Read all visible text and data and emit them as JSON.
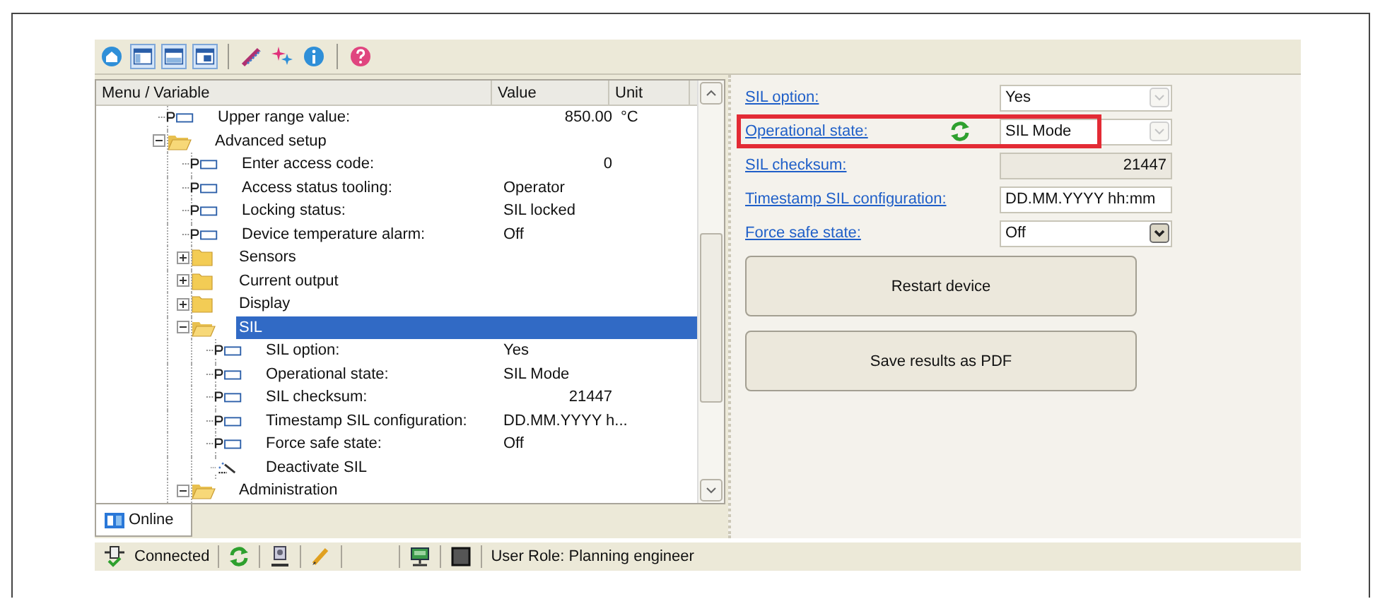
{
  "tree": {
    "columns": [
      "Menu / Variable",
      "Value",
      "Unit"
    ],
    "items": [
      {
        "kind": "param",
        "label": "Upper range value:",
        "value": "850.00",
        "numeric": true,
        "unit": "°C",
        "selected": false
      },
      {
        "kind": "folder",
        "label": "Advanced setup",
        "expanded": true,
        "selected": false,
        "children": [
          {
            "kind": "param",
            "label": "Enter access code:",
            "value": "0",
            "numeric": true,
            "selected": false
          },
          {
            "kind": "param",
            "label": "Access status tooling:",
            "value": "Operator",
            "numeric": false,
            "selected": false
          },
          {
            "kind": "param",
            "label": "Locking status:",
            "value": "SIL locked",
            "numeric": false,
            "selected": false
          },
          {
            "kind": "param",
            "label": "Device temperature alarm:",
            "value": "Off",
            "numeric": false,
            "selected": false
          },
          {
            "kind": "folder",
            "label": "Sensors",
            "expanded": false,
            "selected": false
          },
          {
            "kind": "folder",
            "label": "Current output",
            "expanded": false,
            "selected": false
          },
          {
            "kind": "folder",
            "label": "Display",
            "expanded": false,
            "selected": false
          },
          {
            "kind": "folder",
            "label": "SIL",
            "expanded": true,
            "selected": true,
            "children": [
              {
                "kind": "param",
                "label": "SIL option:",
                "value": "Yes",
                "numeric": false,
                "selected": false
              },
              {
                "kind": "param",
                "label": "Operational state:",
                "value": "SIL Mode",
                "numeric": false,
                "selected": false
              },
              {
                "kind": "param",
                "label": "SIL checksum:",
                "value": "21447",
                "numeric": true,
                "selected": false
              },
              {
                "kind": "param",
                "label": "Timestamp SIL configuration:",
                "value": "DD.MM.YYYY h...",
                "numeric": false,
                "selected": false
              },
              {
                "kind": "param",
                "label": "Force safe state:",
                "value": "Off",
                "numeric": false,
                "selected": false
              },
              {
                "kind": "wizard",
                "label": "Deactivate SIL",
                "selected": false
              }
            ]
          },
          {
            "kind": "folder",
            "label": "Administration",
            "expanded": true,
            "selected": false
          }
        ]
      }
    ]
  },
  "tabs": [
    {
      "label": "Online",
      "selected": true
    }
  ],
  "form": [
    {
      "label": "SIL option:",
      "kind": "dropdown",
      "value": "Yes",
      "disabled": true,
      "highlighted": false,
      "refresh": false
    },
    {
      "label": "Operational state:",
      "kind": "dropdown",
      "value": "SIL Mode",
      "disabled": true,
      "highlighted": true,
      "refresh": true
    },
    {
      "label": "SIL checksum:",
      "kind": "readonly",
      "value": "21447",
      "highlighted": false,
      "refresh": false
    },
    {
      "label": "Timestamp SIL configuration:",
      "kind": "text",
      "value": "DD.MM.YYYY hh:mm",
      "highlighted": false,
      "refresh": false
    },
    {
      "label": "Force safe state:",
      "kind": "dropdown",
      "value": "Off",
      "disabled": false,
      "highlighted": false,
      "refresh": false
    }
  ],
  "buttons": [
    "Restart device",
    "Save results as PDF"
  ],
  "status_bar": {
    "connection": "Connected",
    "user_role": "User Role: Planning engineer"
  }
}
